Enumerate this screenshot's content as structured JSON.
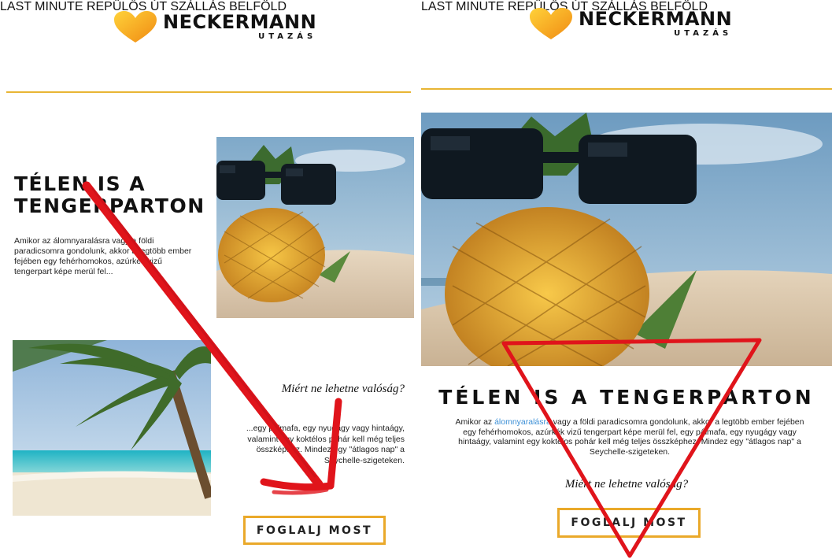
{
  "brand": {
    "name": "NECKERMANN",
    "sub": "UTAZÁS",
    "accent": "#e8b534"
  },
  "nav": {
    "items": [
      {
        "label": "LAST MINUTE"
      },
      {
        "label": "REPÜLŐS ÚT"
      },
      {
        "label": "SZÁLLÁS"
      },
      {
        "label": "BELFÖLD"
      }
    ]
  },
  "left": {
    "title_line1": "TÉLEN IS A",
    "title_line2": "TENGERPARTON",
    "intro": "Amikor az álomnyaralásra vagy a földi paradicsomra gondolunk, akkor a legtöbb ember fejében egy fehérhomokos, azúrkék vizű tengerpart képe merül fel...",
    "subheading": "Miért ne lehetne valóság?",
    "body": "...egy pálmafa, egy nyugágy vagy hintaágy, valamint egy koktélos pohár kell még teljes összképhez. Mindez egy \"átlagos nap\" a Seychelle-szigeteken.",
    "button": "FOGLALJ MOST"
  },
  "right": {
    "title": "TÉLEN IS A TENGERPARTON",
    "intro_before": "Amikor az ",
    "intro_link": "álomnyaralásra",
    "intro_after": " vagy a földi paradicsomra gondolunk, akkor a legtöbb ember fejében egy fehérhomokos, azúrkék vizű tengerpart képe merül fel, egy pálmafa, egy nyugágy vagy hintaágy, valamint egy koktélos pohár kell még teljes összképhez. Mindez egy \"átlagos nap\" a Seychelle-szigeteken.",
    "subheading": "Miért ne lehetne valóság?",
    "button": "FOGLALJ MOST"
  },
  "colors": {
    "annotation": "#e0141b",
    "button_border": "#eaa92a",
    "link": "#3b8fd6"
  }
}
